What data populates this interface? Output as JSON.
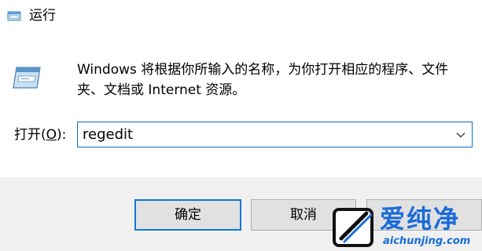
{
  "window": {
    "title": "运行",
    "icon": "run-dialog-icon"
  },
  "dialog": {
    "description": "Windows 将根据你所输入的名称，为你打开相应的程序、文件夹、文档或 Internet 资源。",
    "open_label_prefix": "打开(",
    "open_label_access_key": "O",
    "open_label_suffix": "):",
    "command_value": "regedit",
    "icon": "run-program-icon"
  },
  "buttons": {
    "ok_label": "确定",
    "cancel_label": "取消",
    "browse_label": ""
  },
  "watermark": {
    "title": "爱纯净",
    "url": "aichunjing.com",
    "color": "#1a6bd8"
  },
  "colors": {
    "focus_border": "#0b6fc9",
    "footer_bg": "#f0f0f0",
    "button_bg": "#e1e1e1"
  }
}
